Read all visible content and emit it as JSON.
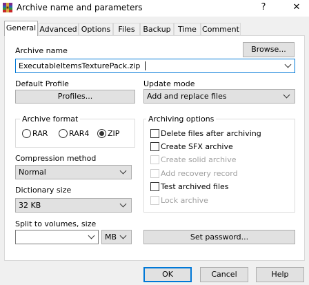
{
  "window": {
    "title": "Archive name and parameters",
    "help_glyph": "?",
    "close_glyph": "✕"
  },
  "tabs": [
    "General",
    "Advanced",
    "Options",
    "Files",
    "Backup",
    "Time",
    "Comment"
  ],
  "archive_name": {
    "label": "Archive name",
    "value": "ExecutableItemsTexturePack.zip",
    "browse_label": "Browse..."
  },
  "default_profile": {
    "label": "Default Profile",
    "button_label": "Profiles..."
  },
  "update_mode": {
    "label": "Update mode",
    "value": "Add and replace files"
  },
  "archive_format": {
    "label": "Archive format",
    "options": [
      "RAR",
      "RAR4",
      "ZIP"
    ],
    "selected": "ZIP"
  },
  "archiving_options": {
    "label": "Archiving options",
    "items": [
      {
        "label": "Delete files after archiving",
        "checked": false,
        "enabled": true
      },
      {
        "label": "Create SFX archive",
        "checked": false,
        "enabled": true
      },
      {
        "label": "Create solid archive",
        "checked": false,
        "enabled": false
      },
      {
        "label": "Add recovery record",
        "checked": false,
        "enabled": false
      },
      {
        "label": "Test archived files",
        "checked": false,
        "enabled": true
      },
      {
        "label": "Lock archive",
        "checked": false,
        "enabled": false
      }
    ]
  },
  "compression": {
    "label": "Compression method",
    "value": "Normal"
  },
  "dictionary": {
    "label": "Dictionary size",
    "value": "32 KB"
  },
  "split": {
    "label": "Split to volumes, size",
    "value": "",
    "unit": "MB"
  },
  "set_password_label": "Set password...",
  "buttons": {
    "ok": "OK",
    "cancel": "Cancel",
    "help": "Help"
  }
}
